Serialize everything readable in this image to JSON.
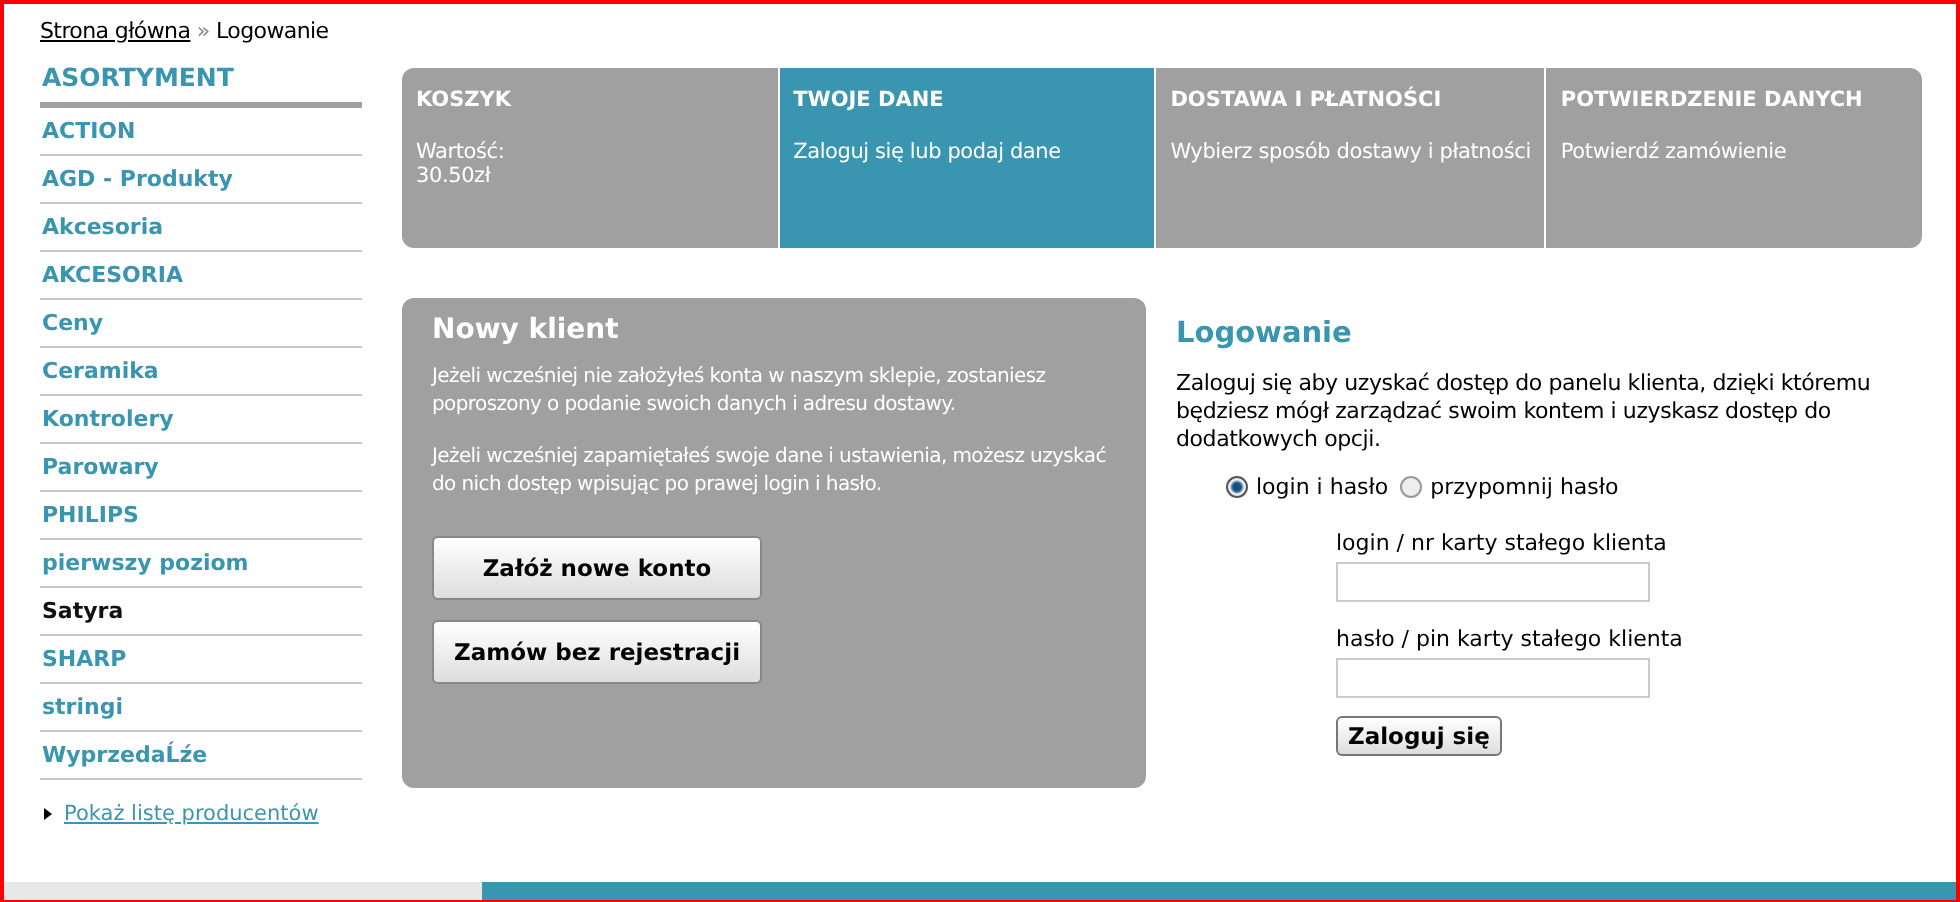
{
  "breadcrumb": {
    "link": "Strona główna",
    "separator": "»",
    "current": "Logowanie"
  },
  "sidebar": {
    "title": "ASORTYMENT",
    "items": [
      {
        "label": "ACTION",
        "selected": false
      },
      {
        "label": "AGD - Produkty",
        "selected": false
      },
      {
        "label": "Akcesoria",
        "selected": false
      },
      {
        "label": "AKCESORIA",
        "selected": false
      },
      {
        "label": "Ceny",
        "selected": false
      },
      {
        "label": "Ceramika",
        "selected": false
      },
      {
        "label": "Kontrolery",
        "selected": false
      },
      {
        "label": "Parowary",
        "selected": false
      },
      {
        "label": "PHILIPS",
        "selected": false
      },
      {
        "label": "pierwszy poziom",
        "selected": false
      },
      {
        "label": "Satyra",
        "selected": true
      },
      {
        "label": "SHARP",
        "selected": false
      },
      {
        "label": "stringi",
        "selected": false
      },
      {
        "label": "WyprzedaĹźe",
        "selected": false
      }
    ],
    "producers_link": "Pokaż listę producentów"
  },
  "steps": [
    {
      "title": "KOSZYK",
      "lines": [
        "Wartość:",
        "30.50zł"
      ],
      "selected": false
    },
    {
      "title": "TWOJE DANE",
      "lines": [
        "Zaloguj się lub podaj dane"
      ],
      "selected": true
    },
    {
      "title": "DOSTAWA I PŁATNOŚCI",
      "lines": [
        "Wybierz sposób dostawy i płatności"
      ],
      "selected": false
    },
    {
      "title": "POTWIERDZENIE DANYCH",
      "lines": [
        "Potwierdź zamówienie"
      ],
      "selected": false
    }
  ],
  "new_client": {
    "title": "Nowy klient",
    "paragraphs": [
      "Jeżeli wcześniej nie założyłeś konta w naszym sklepie, zostaniesz poproszony o podanie swoich danych i adresu dostawy.",
      "Jeżeli wcześniej zapamiętałeś swoje dane i ustawienia, możesz uzyskać do nich dostęp wpisując po prawej login i hasło."
    ],
    "buttons": [
      "Załóż nowe konto",
      "Zamów bez rejestracji"
    ]
  },
  "login": {
    "title": "Logowanie",
    "description": "Zaloguj się aby uzyskać dostęp do panelu klienta, dzięki któremu będziesz mógł zarządzać swoim kontem i uzyskasz dostęp do dodatkowych opcji.",
    "modes": [
      {
        "label": "login i hasło",
        "selected": true
      },
      {
        "label": "przypomnij hasło",
        "selected": false
      }
    ],
    "fields": [
      {
        "label": "login / nr karty stałego klienta"
      },
      {
        "label": "hasło / pin karty stałego klienta"
      }
    ],
    "submit": "Zaloguj się"
  }
}
